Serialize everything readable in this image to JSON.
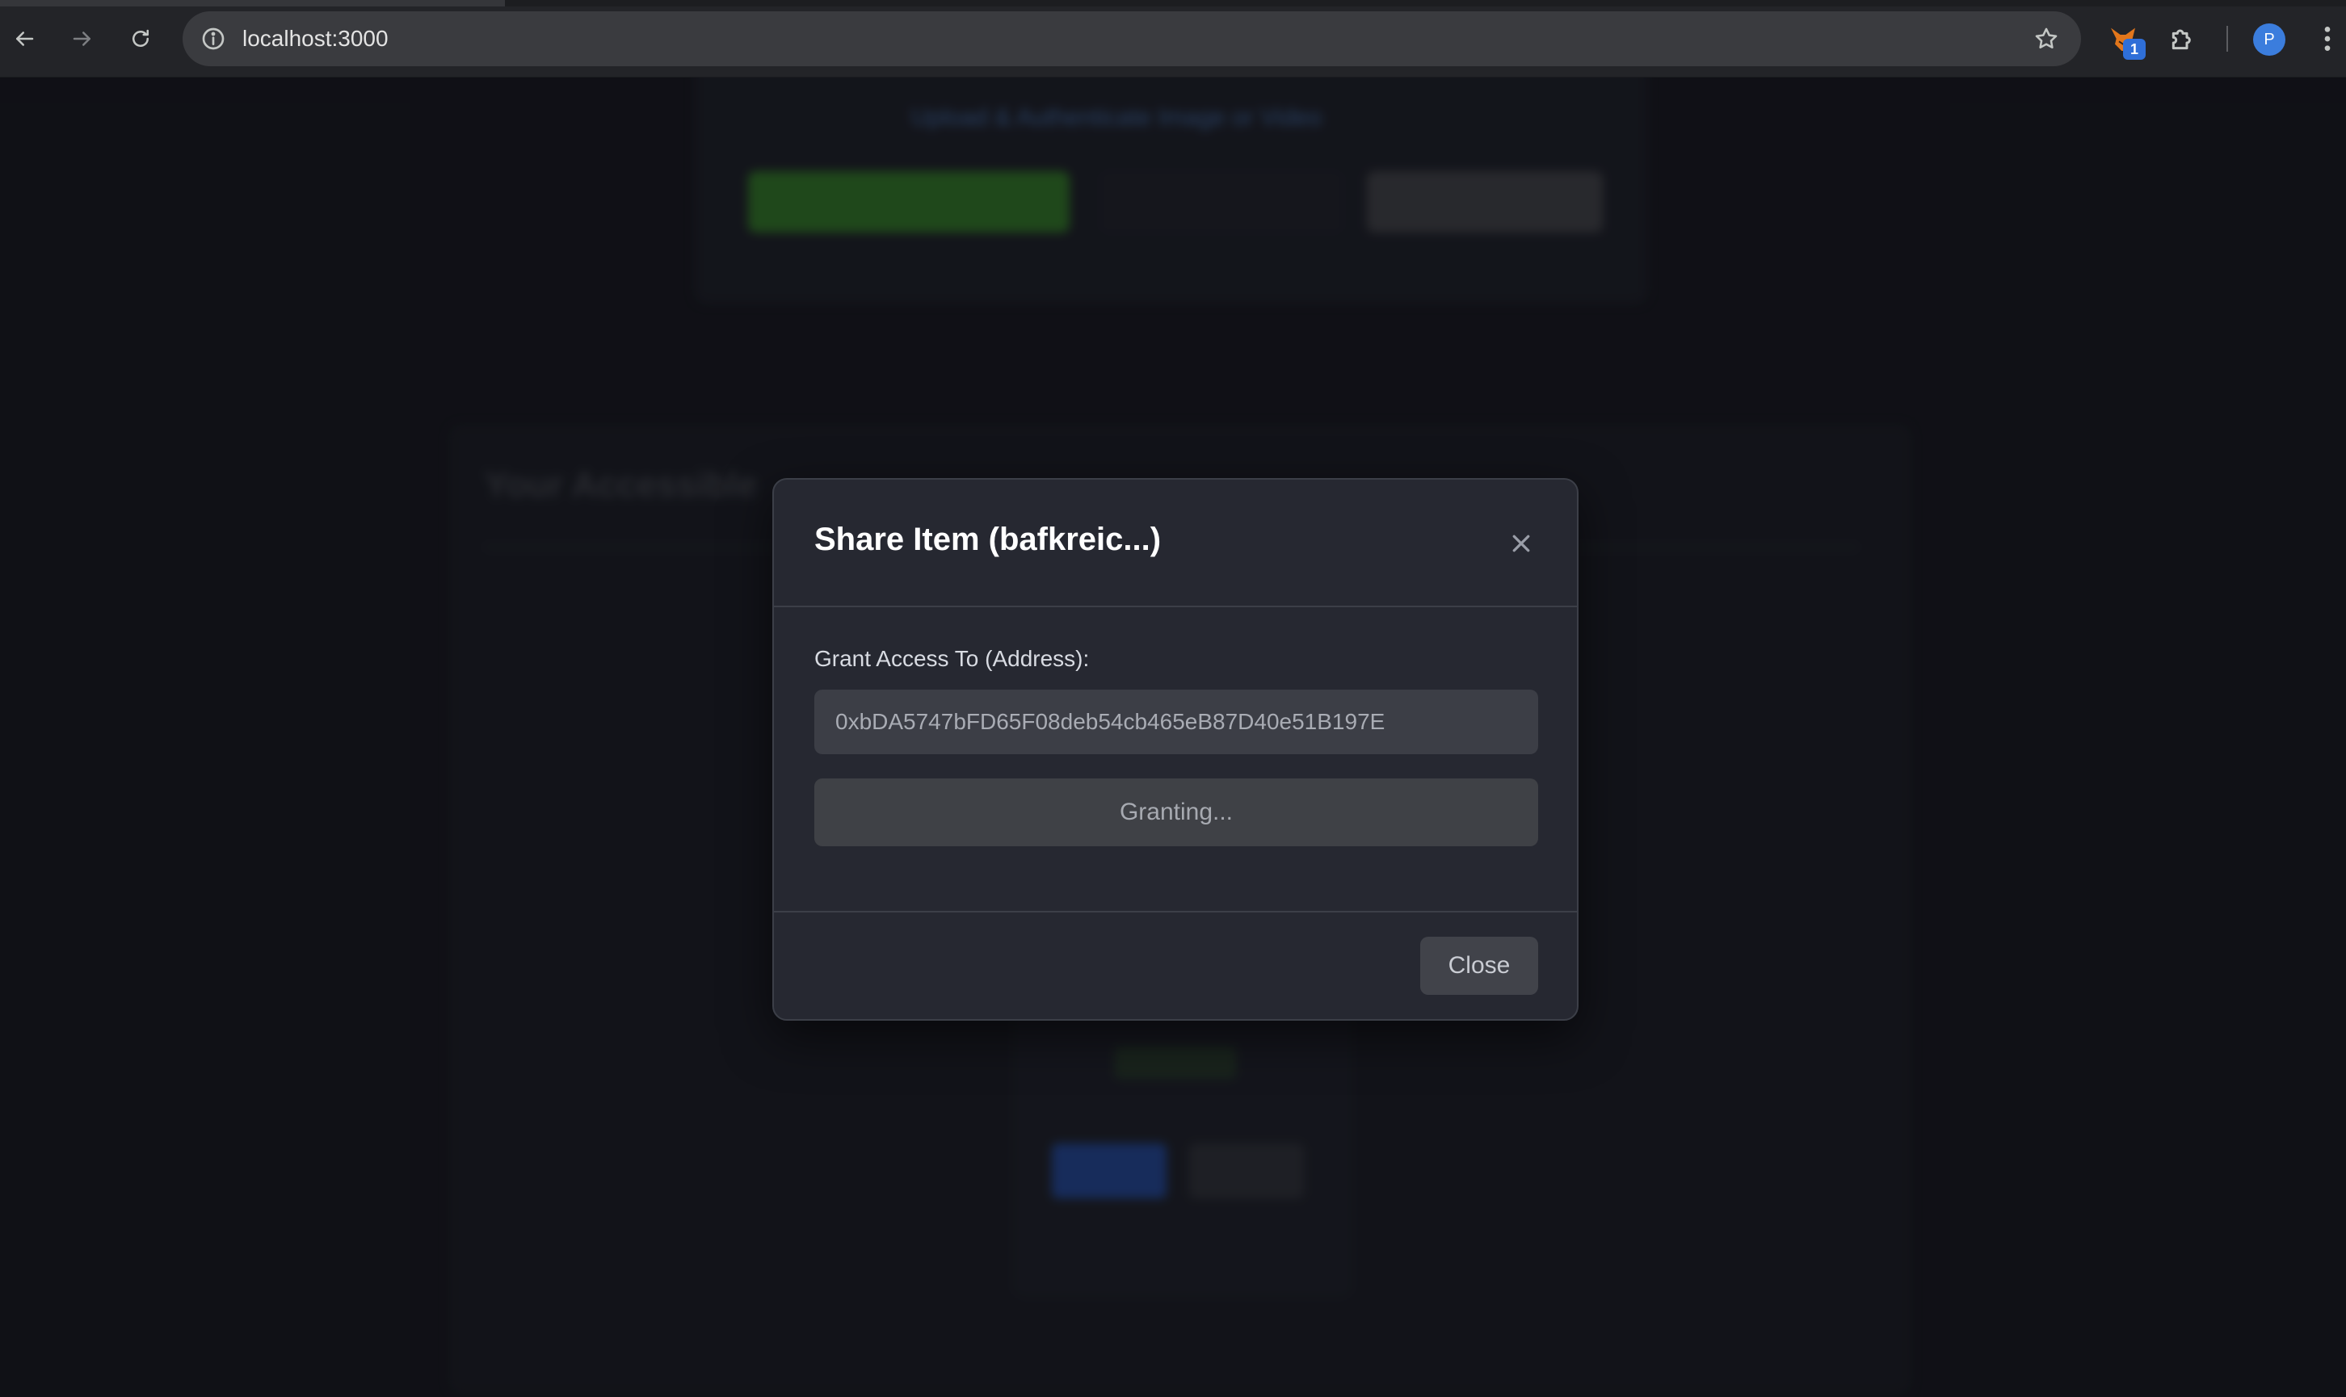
{
  "browser": {
    "url": "localhost:3000",
    "extension_badge": "1",
    "profile_initial": "P"
  },
  "background_page": {
    "link_text": "Upload & Authenticate Image or Video",
    "heading": "Your Accessible"
  },
  "modal": {
    "title": "Share Item (bafkreic...)",
    "field_label": "Grant Access To (Address):",
    "address_value": "0xbDA5747bFD65F08deb54cb465eB87D40e51B197E",
    "grant_button_label": "Granting...",
    "close_button_label": "Close"
  },
  "icons": {
    "back": "arrow-left-icon",
    "forward": "arrow-right-icon",
    "reload": "reload-icon",
    "info": "info-icon",
    "bookmark": "star-icon",
    "extension": "fox-extension-icon",
    "extensions_menu": "puzzle-icon",
    "menu": "kebab-menu-icon",
    "close": "close-icon"
  },
  "colors": {
    "modal_bg": "#262831",
    "page_bg": "#14151c",
    "avatar": "#3b7ddd",
    "badge": "#2f6fd8"
  }
}
